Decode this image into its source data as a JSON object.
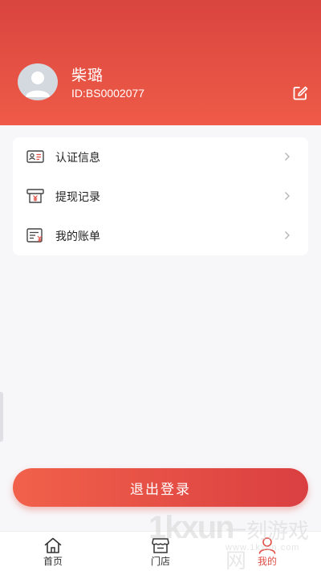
{
  "profile": {
    "name": "柴璐",
    "id_text": "ID:BS0002077"
  },
  "menu": {
    "items": [
      {
        "label": "认证信息",
        "icon": "id-card-icon"
      },
      {
        "label": "提现记录",
        "icon": "withdraw-icon"
      },
      {
        "label": "我的账单",
        "icon": "bill-icon"
      }
    ]
  },
  "actions": {
    "logout_label": "退出登录"
  },
  "tabbar": {
    "tabs": [
      {
        "label": "首页",
        "icon": "home-icon"
      },
      {
        "label": "门店",
        "icon": "store-icon"
      },
      {
        "label": "我的",
        "icon": "user-icon",
        "active": true
      }
    ]
  },
  "watermark": {
    "logo": "1kxun",
    "text": "一刻游戏网",
    "url": "www.1kxun.com"
  },
  "colors": {
    "brand": "#e04e45",
    "header_top": "#d9453f",
    "header_bottom": "#ef5b47",
    "background": "#f7f6f9"
  }
}
